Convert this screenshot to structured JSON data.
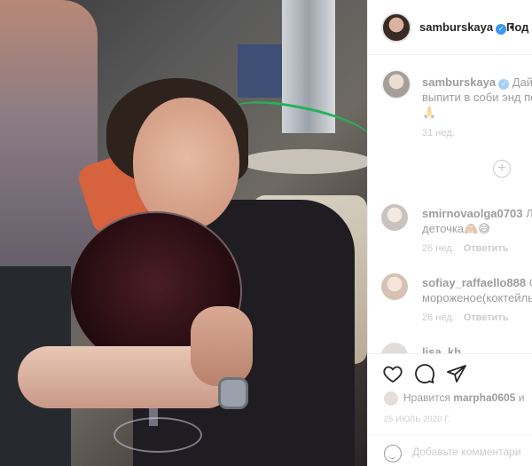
{
  "header": {
    "username": "samburskaya",
    "follow_label": "Под"
  },
  "caption": {
    "username": "samburskaya",
    "text_line1": "Дай г",
    "text_line2": "выпити в соби энд пе",
    "emoji": "🙏",
    "time": "31 нед."
  },
  "comments": [
    {
      "username": "smirnovaolga0703",
      "text_suffix": "Ло",
      "text_line2": "деточка🙈😅",
      "time": "26 нед.",
      "reply_label": "Ответить"
    },
    {
      "username": "sofiay_raffaello888",
      "text_suffix": "Су",
      "text_line2": "мороженое(коктейль",
      "time": "26 нед.",
      "reply_label": "Ответить"
    },
    {
      "username": "lisa_kh...",
      "text_suffix": "",
      "text_line2": "",
      "time": "",
      "reply_label": ""
    }
  ],
  "likes": {
    "prefix": "Нравится",
    "user": "marpha0605",
    "suffix": "и"
  },
  "date": "25 ИЮЛЬ 2020 Г.",
  "add_comment_placeholder": "Добавьте комментари",
  "colors": {
    "verified": "#3897f0",
    "muted": "#8e8e8e",
    "text": "#262626",
    "border": "#efefef"
  }
}
